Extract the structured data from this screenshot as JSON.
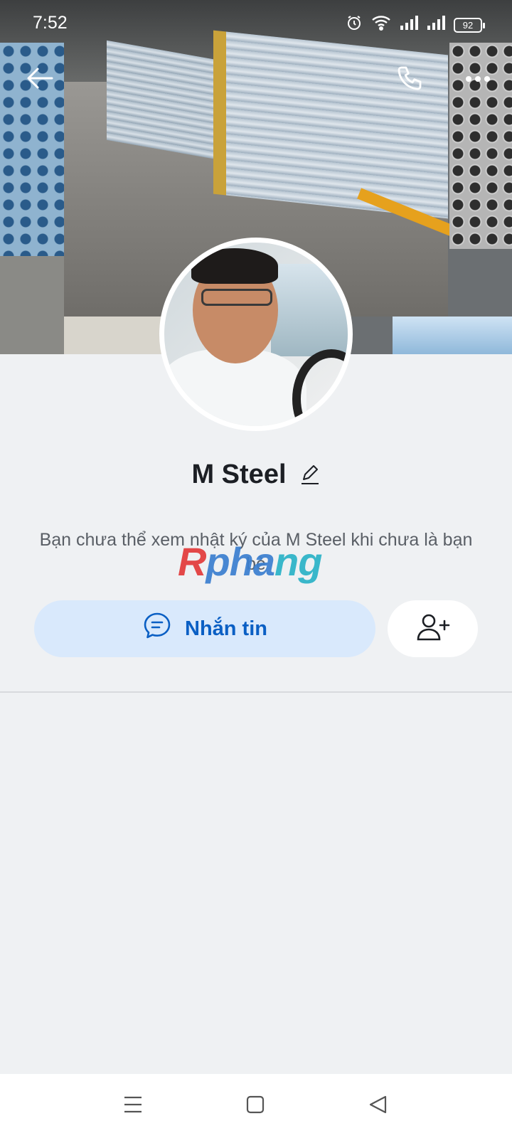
{
  "status_bar": {
    "time": "7:52",
    "battery": "92"
  },
  "profile": {
    "name": "M Steel",
    "notice": "Bạn chưa thể xem nhật ký của M Steel khi chưa là bạn bè"
  },
  "actions": {
    "message_label": "Nhắn tin"
  },
  "watermark": {
    "part_a": "R",
    "part_b": "pha",
    "part_c": "ng"
  },
  "colors": {
    "accent": "#0a5fc4",
    "message_button_bg": "#d9e9fc",
    "page_bg": "#eff1f3"
  },
  "icons": {
    "back": "arrow-left-icon",
    "call": "phone-icon",
    "more": "more-dots-icon",
    "edit": "pencil-icon",
    "message": "chat-bubble-icon",
    "add_friend": "add-user-icon"
  }
}
